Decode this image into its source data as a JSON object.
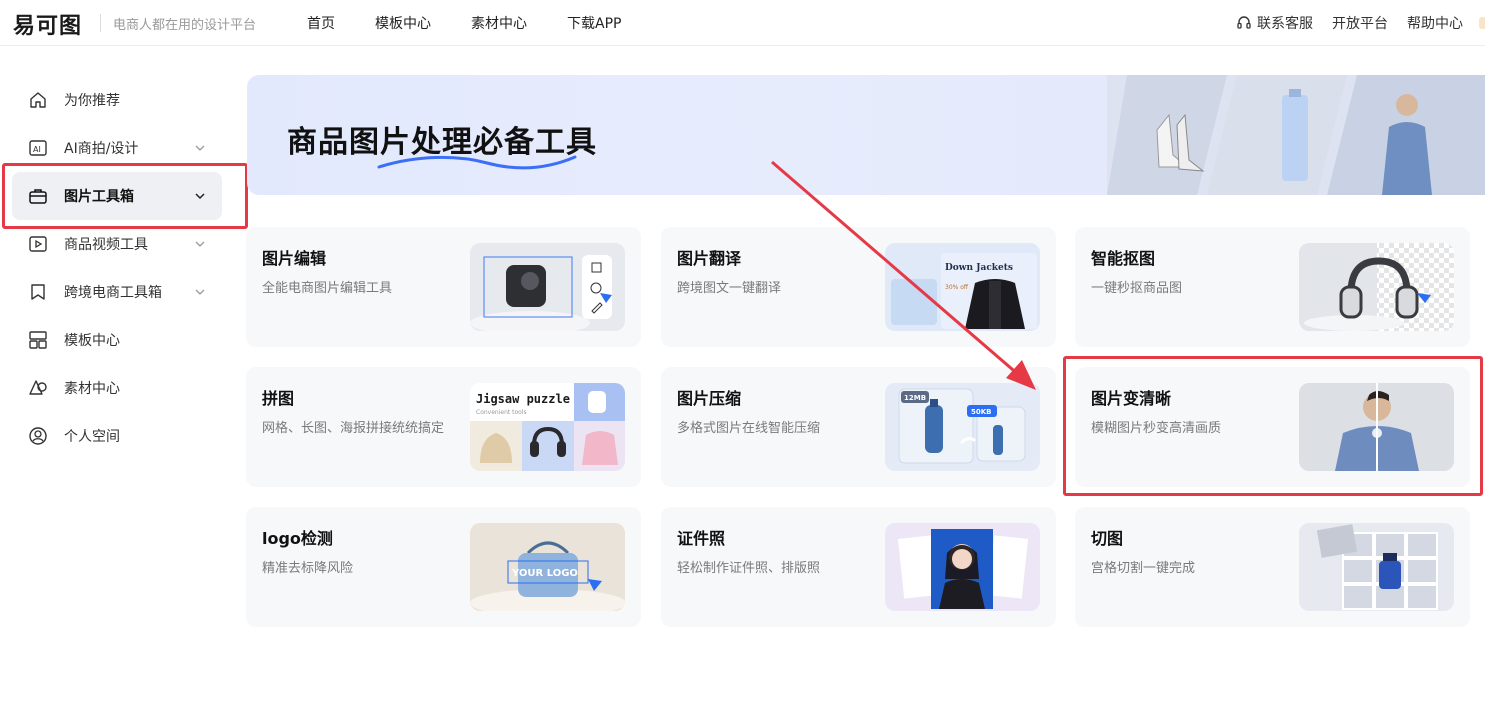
{
  "header": {
    "logo": "易可图",
    "slogan": "电商人都在用的设计平台",
    "nav": [
      "首页",
      "模板中心",
      "素材中心",
      "下载APP"
    ],
    "right_links": [
      "联系客服",
      "开放平台",
      "帮助中心"
    ]
  },
  "sidebar": {
    "items": [
      {
        "label": "为你推荐",
        "icon": "home-icon",
        "expandable": false
      },
      {
        "label": "AI商拍/设计",
        "icon": "ai-icon",
        "expandable": true
      },
      {
        "label": "图片工具箱",
        "icon": "toolbox-icon",
        "expandable": true,
        "active": true
      },
      {
        "label": "商品视频工具",
        "icon": "play-icon",
        "expandable": true
      },
      {
        "label": "跨境电商工具箱",
        "icon": "bookmark-icon",
        "expandable": true
      },
      {
        "label": "模板中心",
        "icon": "layout-icon",
        "expandable": false
      },
      {
        "label": "素材中心",
        "icon": "shapes-icon",
        "expandable": false
      },
      {
        "label": "个人空间",
        "icon": "user-icon",
        "expandable": false
      }
    ]
  },
  "banner": {
    "title": "商品图片处理必备工具"
  },
  "tools": [
    {
      "title": "图片编辑",
      "desc": "全能电商图片编辑工具"
    },
    {
      "title": "图片翻译",
      "desc": "跨境图文一键翻译"
    },
    {
      "title": "智能抠图",
      "desc": "一键秒抠商品图"
    },
    {
      "title": "拼图",
      "desc": "网格、长图、海报拼接统统搞定"
    },
    {
      "title": "图片压缩",
      "desc": "多格式图片在线智能压缩"
    },
    {
      "title": "图片变清晰",
      "desc": "模糊图片秒变高清画质"
    },
    {
      "title": "logo检测",
      "desc": "精准去标降风险"
    },
    {
      "title": "证件照",
      "desc": "轻松制作证件照、排版照"
    },
    {
      "title": "切图",
      "desc": "宫格切割一键完成"
    }
  ],
  "thumb_text": {
    "translate_tag": "Down Jackets",
    "translate_off": "30% off",
    "jigsaw_title": "Jigsaw puzzle",
    "jigsaw_sub": "Convenient tools",
    "compress_before": "12MB",
    "compress_after": "50KB",
    "logo_text": "YOUR LOGO"
  },
  "colors": {
    "annotation_red": "#e63946",
    "accent_blue": "#2b6ef2",
    "banner_bg": "#e3e9fd"
  }
}
